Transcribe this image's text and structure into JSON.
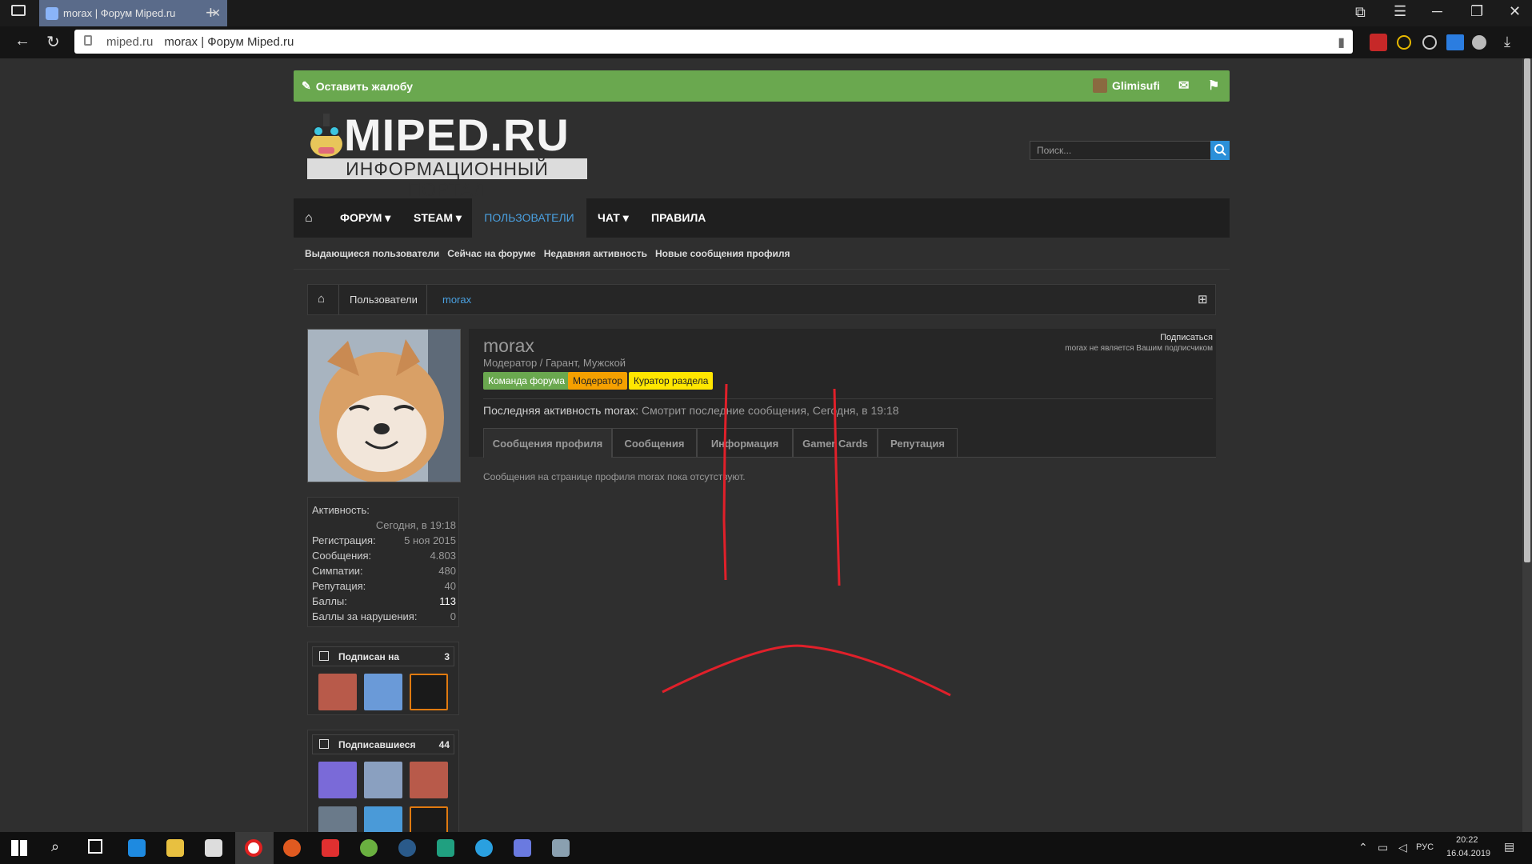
{
  "browser": {
    "tab_title": "morax | Форум Miped.ru",
    "url_host": "miped.ru",
    "url_title": "morax | Форум Miped.ru"
  },
  "topbar": {
    "complain": "Оставить жалобу",
    "user": "Glimisufi"
  },
  "logo": {
    "line1": "MIPED.RU",
    "line2": "ИНФОРМАЦИОННЫЙ ПОРТАЛ"
  },
  "search": {
    "placeholder": "Поиск..."
  },
  "nav": {
    "forum": "ФОРУМ",
    "steam": "STEAM",
    "users": "ПОЛЬЗОВАТЕЛИ",
    "chat": "ЧАТ",
    "rules": "ПРАВИЛА"
  },
  "subnav": [
    "Выдающиеся пользователи",
    "Сейчас на форуме",
    "Недавняя активность",
    "Новые сообщения профиля"
  ],
  "breadcrumb": {
    "users": "Пользователи",
    "current": "morax"
  },
  "profile": {
    "username": "morax",
    "title": "Модератор / Гарант, Мужской",
    "badges": [
      "Команда форума",
      "Модератор",
      "Куратор раздела"
    ],
    "last_activity_label": "Последняя активность morax:",
    "last_activity": "Смотрит последние сообщения, Сегодня, в 19:18",
    "subscribe": "Подписаться",
    "subscribe_note": "morax не является Вашим подписчиком",
    "tabs": [
      "Сообщения профиля",
      "Сообщения",
      "Информация",
      "Gamer Cards",
      "Репутация"
    ],
    "empty_text": "Сообщения на странице профиля morax пока отсутствуют."
  },
  "stats": {
    "activity_label": "Активность:",
    "activity": "Сегодня, в 19:18",
    "reg_label": "Регистрация:",
    "reg": "5 ноя 2015",
    "msgs_label": "Сообщения:",
    "msgs": "4.803",
    "likes_label": "Симпатии:",
    "likes": "480",
    "rep_label": "Репутация:",
    "rep": "40",
    "points_label": "Баллы:",
    "points": "113",
    "violations_label": "Баллы за нарушения:",
    "violations": "0"
  },
  "following": {
    "label": "Подписан на",
    "count": "3"
  },
  "followers": {
    "label": "Подписавшиеся",
    "count": "44"
  },
  "tray": {
    "lang": "РУС",
    "time": "20:22",
    "date": "16.04.2019"
  },
  "colors": {
    "green": "#6aa84f",
    "accent": "#4aa0e0",
    "badge_green": "#6aa84f",
    "badge_orange": "#f5a000",
    "badge_yellow": "#ffe600",
    "scribble": "#e0202a"
  }
}
